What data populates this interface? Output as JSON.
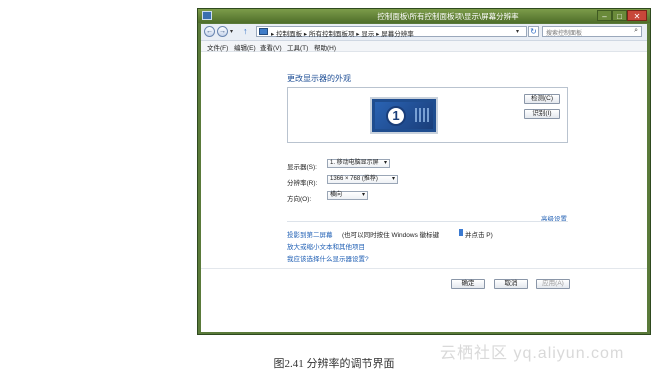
{
  "window": {
    "title": "控制面板\\所有控制面板项\\显示\\屏幕分辨率",
    "min_glyph": "–",
    "max_glyph": "□",
    "close_glyph": "✕"
  },
  "nav": {
    "back_glyph": "←",
    "forward_glyph": "→",
    "recent_glyph": "▾",
    "up_glyph": "↑",
    "breadcrumbs": "▸ 控制面板  ▸ 所有控制面板项  ▸ 显示  ▸ 屏幕分辨率",
    "address_drop_glyph": "▾",
    "refresh_glyph": "↻",
    "search_placeholder": "搜索控制面板",
    "search_glyph": "⌕"
  },
  "menu": [
    "文件(F)",
    "编辑(E)",
    "查看(V)",
    "工具(T)",
    "帮助(H)"
  ],
  "main": {
    "title": "更改显示器的外观",
    "monitor_number": "1",
    "detect_label": "检测(C)",
    "identify_label": "识别(I)",
    "display_label": "显示器(S):",
    "display_value": "1. 移动电脑显示屏",
    "resolution_label": "分辨率(R):",
    "resolution_value": "1366 × 768 (推荐)",
    "orientation_label": "方向(O):",
    "orientation_value": "横向",
    "dropdown_glyph": "▾",
    "advanced_link": "高级设置",
    "link1": "投影到第二屏幕",
    "link1_suffix": "(也可以同时按住 Windows 徽标键",
    "link1_tail": "并点击 P)",
    "link2": "放大或缩小文本和其他项目",
    "link3": "我应该选择什么显示器设置?"
  },
  "buttons": {
    "ok": "确定",
    "cancel": "取消",
    "apply": "应用(A)"
  },
  "caption": "图2.41 分辨率的调节界面",
  "watermark": "云栖社区 yq.aliyun.com"
}
